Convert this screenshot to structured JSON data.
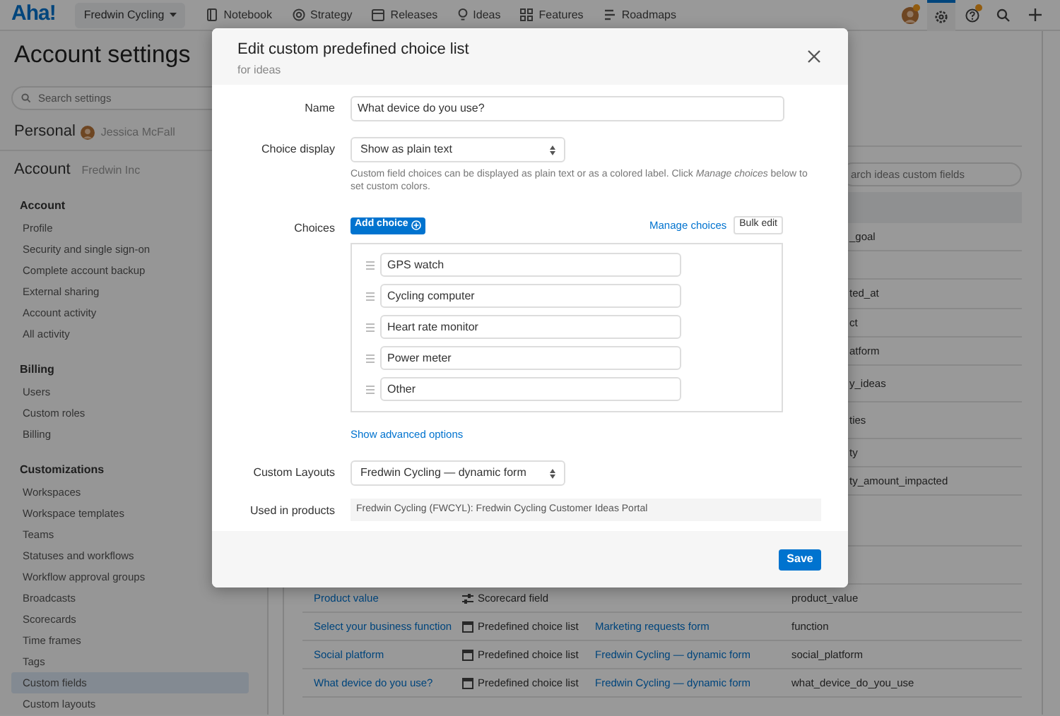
{
  "topbar": {
    "logo": "Aha!",
    "product": "Fredwin Cycling",
    "nav": [
      {
        "kind": "notebook",
        "label": "Notebook"
      },
      {
        "kind": "strategy",
        "label": "Strategy"
      },
      {
        "kind": "releases",
        "label": "Releases"
      },
      {
        "kind": "ideas",
        "label": "Ideas"
      },
      {
        "kind": "features",
        "label": "Features"
      },
      {
        "kind": "roadmaps",
        "label": "Roadmaps"
      }
    ],
    "tools": [
      {
        "kind": "avatar",
        "badge": true,
        "selected": false
      },
      {
        "kind": "settings",
        "selected": true
      },
      {
        "kind": "help",
        "badge": true,
        "selected": false
      },
      {
        "kind": "search",
        "selected": false
      },
      {
        "kind": "add",
        "selected": false
      }
    ]
  },
  "sidebar": {
    "page_title": "Account settings",
    "search": {
      "placeholder": "Search settings"
    },
    "personal": {
      "label": "Personal",
      "user": "Jessica McFall"
    },
    "account": {
      "label": "Account",
      "org": "Fredwin Inc"
    },
    "sections": [
      {
        "title": "Account",
        "items": [
          {
            "label": "Profile",
            "selected": false
          },
          {
            "label": "Security and single sign-on",
            "selected": false
          },
          {
            "label": "Complete account backup",
            "selected": false
          },
          {
            "label": "External sharing",
            "selected": false
          },
          {
            "label": "Account activity",
            "selected": false
          },
          {
            "label": "All activity",
            "selected": false
          }
        ]
      },
      {
        "title": "Billing",
        "items": [
          {
            "label": "Users",
            "selected": false
          },
          {
            "label": "Custom roles",
            "selected": false
          },
          {
            "label": "Billing",
            "selected": false
          }
        ]
      },
      {
        "title": "Customizations",
        "items": [
          {
            "label": "Workspaces",
            "selected": false
          },
          {
            "label": "Workspace templates",
            "selected": false
          },
          {
            "label": "Teams",
            "selected": false
          },
          {
            "label": "Statuses and workflows",
            "selected": false
          },
          {
            "label": "Workflow approval groups",
            "selected": false
          },
          {
            "label": "Broadcasts",
            "selected": false
          },
          {
            "label": "Scorecards",
            "selected": false
          },
          {
            "label": "Time frames",
            "selected": false
          },
          {
            "label": "Tags",
            "selected": false
          },
          {
            "label": "Custom fields",
            "selected": true
          },
          {
            "label": "Custom layouts",
            "selected": false
          }
        ]
      }
    ]
  },
  "main": {
    "search": {
      "placeholder": "arch ideas custom fields"
    },
    "partial_rows": [
      {
        "column_4": "_goal"
      },
      {
        "column_4": "ted_at"
      },
      {
        "column_4": "ct"
      },
      {
        "column_4": "atform"
      },
      {
        "column_4": "y_ideas"
      },
      {
        "column_4": "ties"
      },
      {
        "column_4": "ty"
      },
      {
        "column_4": "ty_amount_impacted"
      }
    ],
    "rows": [
      {
        "name": "Product value",
        "kind": "scorecard",
        "type": "Scorecard field",
        "key": "product_value"
      },
      {
        "name": "Select your business function",
        "kind": "choice",
        "type": "Predefined choice list",
        "form": "Marketing requests form",
        "key": "function"
      },
      {
        "name": "Social platform",
        "kind": "choice",
        "type": "Predefined choice list",
        "form": "Fredwin Cycling — dynamic form",
        "key": "social_platform"
      },
      {
        "name": "What device do you use?",
        "kind": "choice",
        "type": "Predefined choice list",
        "form": "Fredwin Cycling — dynamic form",
        "key": "what_device_do_you_use"
      }
    ]
  },
  "modal": {
    "title": "Edit custom predefined choice list",
    "subtitle": "for ideas",
    "name": {
      "label": "Name",
      "value": "What device do you use?"
    },
    "choice_display": {
      "label": "Choice display",
      "value": "Show as plain text",
      "help": "Custom field choices can be displayed as plain text or as a colored label. Click *Manage choices* below to set custom colors."
    },
    "choices": {
      "label": "Choices",
      "add_button": "Add choice",
      "manage_link": "Manage choices",
      "bulk_button": "Bulk edit",
      "items": [
        "GPS watch",
        "Cycling computer",
        "Heart rate monitor",
        "Power meter",
        "Other"
      ]
    },
    "advanced_link": "Show advanced options",
    "custom_layouts": {
      "label": "Custom Layouts",
      "value": "Fredwin Cycling — dynamic form"
    },
    "used_in": {
      "label": "Used in products",
      "value": "Fredwin Cycling (FWCYL): Fredwin Cycling Customer Ideas Portal"
    },
    "save_button": "Save"
  }
}
